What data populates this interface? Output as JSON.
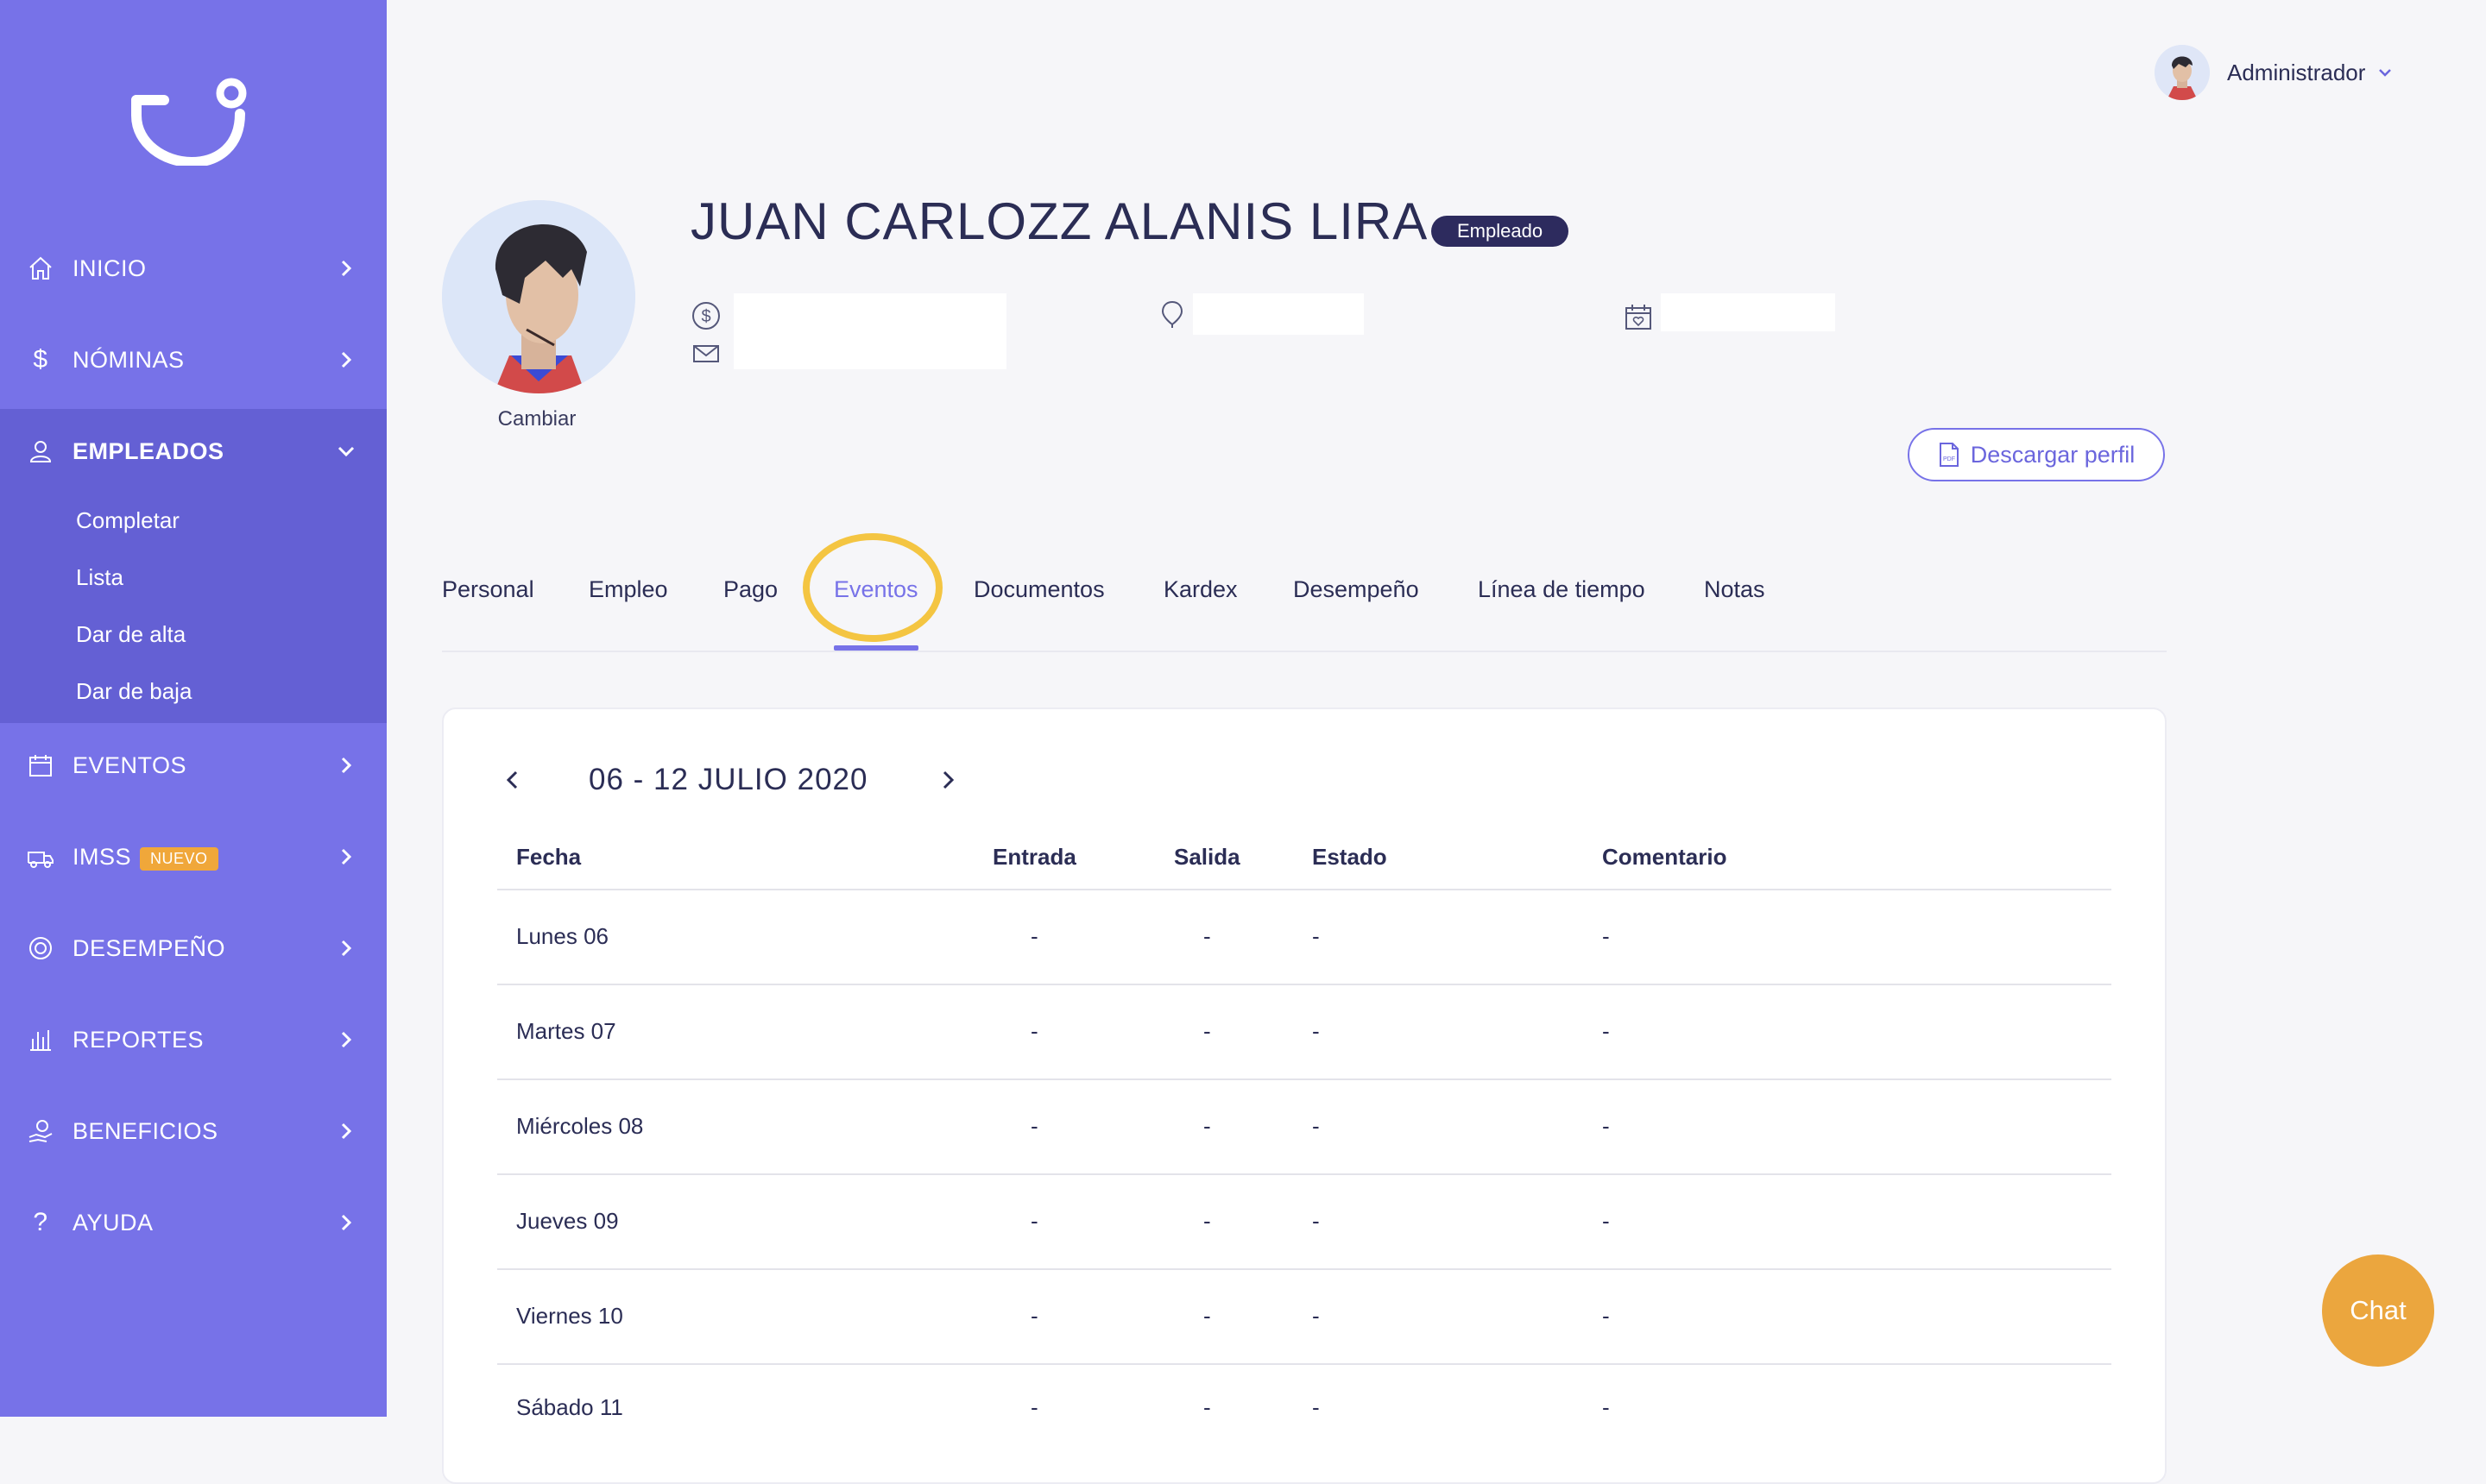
{
  "sidebar": {
    "items": [
      {
        "label": "INICIO",
        "icon": "home-icon"
      },
      {
        "label": "NÓMINAS",
        "icon": "dollar-icon"
      },
      {
        "label": "EMPLEADOS",
        "icon": "user-icon"
      },
      {
        "label": "EVENTOS",
        "icon": "calendar-icon"
      },
      {
        "label": "IMSS",
        "icon": "ambulance-icon",
        "badge": "NUEVO"
      },
      {
        "label": "DESEMPEÑO",
        "icon": "target-icon"
      },
      {
        "label": "REPORTES",
        "icon": "bar-chart-icon"
      },
      {
        "label": "BENEFICIOS",
        "icon": "benefits-icon"
      },
      {
        "label": "AYUDA",
        "icon": "help-icon"
      }
    ],
    "submenu": [
      "Completar",
      "Lista",
      "Dar de alta",
      "Dar de baja"
    ]
  },
  "header": {
    "user": "Administrador"
  },
  "profile": {
    "name": "JUAN CARLOZZ ALANIS LIRA",
    "badge": "Empleado",
    "change_photo": "Cambiar",
    "download_button": "Descargar perfil"
  },
  "tabs": [
    {
      "label": "Personal"
    },
    {
      "label": "Empleo"
    },
    {
      "label": "Pago"
    },
    {
      "label": "Eventos",
      "active": true
    },
    {
      "label": "Documentos"
    },
    {
      "label": "Kardex"
    },
    {
      "label": "Desempeño"
    },
    {
      "label": "Línea de tiempo"
    },
    {
      "label": "Notas"
    }
  ],
  "events": {
    "week_label": "06 - 12 JULIO 2020",
    "columns": [
      "Fecha",
      "Entrada",
      "Salida",
      "Estado",
      "Comentario"
    ],
    "rows": [
      [
        "Lunes 06",
        "-",
        "-",
        "-",
        "-"
      ],
      [
        "Martes 07",
        "-",
        "-",
        "-",
        "-"
      ],
      [
        "Miércoles 08",
        "-",
        "-",
        "-",
        "-"
      ],
      [
        "Jueves 09",
        "-",
        "-",
        "-",
        "-"
      ],
      [
        "Viernes 10",
        "-",
        "-",
        "-",
        "-"
      ],
      [
        "Sábado 11",
        "-",
        "-",
        "-",
        "-"
      ]
    ]
  },
  "chat": {
    "label": "Chat"
  },
  "colors": {
    "sidebar": "#7772e8",
    "sidebar_active": "#6460d4",
    "accent": "#7772e8",
    "badge_new": "#f0a73a",
    "highlight": "#f4c542",
    "chat": "#eba63e",
    "text": "#2b2d55"
  }
}
